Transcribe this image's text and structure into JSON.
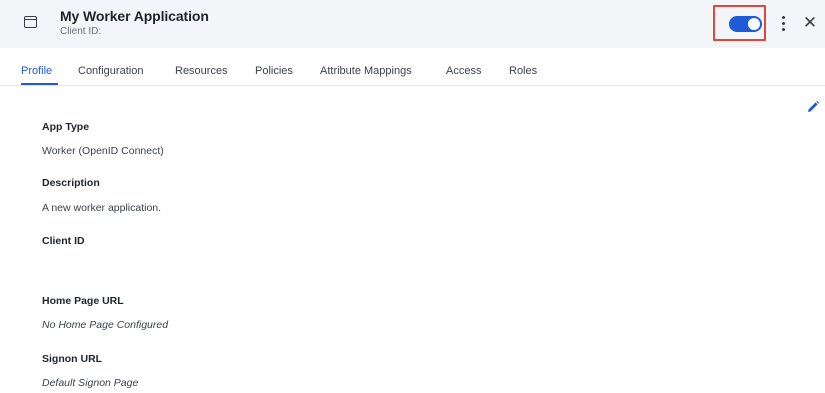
{
  "header": {
    "title": "My Worker Application",
    "subtitle": "Client ID:",
    "toggle": {
      "enabled": true,
      "accent_color": "#1f5bd6",
      "highlight_color": "#e2483a"
    },
    "icons": {
      "app": "app-window-icon",
      "more": "more-vertical-icon",
      "close": "close-icon"
    }
  },
  "tabs": [
    {
      "label": "Profile",
      "active": true
    },
    {
      "label": "Configuration",
      "active": false
    },
    {
      "label": "Resources",
      "active": false
    },
    {
      "label": "Policies",
      "active": false
    },
    {
      "label": "Attribute Mappings",
      "active": false
    },
    {
      "label": "Access",
      "active": false
    },
    {
      "label": "Roles",
      "active": false
    }
  ],
  "profile": {
    "edit_icon": "pencil-icon",
    "fields": [
      {
        "label": "App Type",
        "value": "Worker (OpenID Connect)"
      },
      {
        "label": "Description",
        "value": "A new worker application."
      },
      {
        "label": "Client ID",
        "value": ""
      },
      {
        "label": "Home Page URL",
        "value": "No Home Page Configured"
      },
      {
        "label": "Signon URL",
        "value": "Default Signon Page"
      }
    ]
  }
}
